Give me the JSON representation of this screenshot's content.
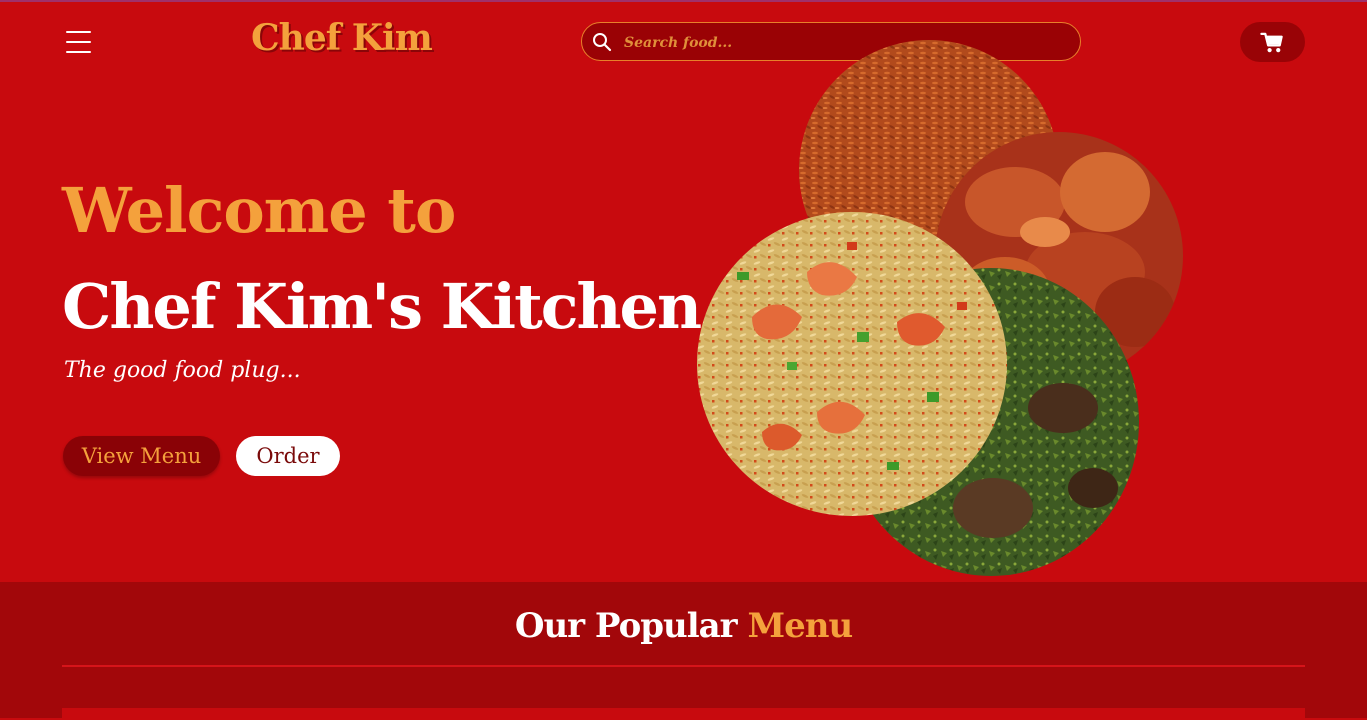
{
  "header": {
    "logo": "Chef Kim",
    "search_placeholder": "Search food...",
    "menu_icon": "hamburger-menu-icon",
    "search_icon": "search-icon",
    "cart_icon": "shopping-cart-icon"
  },
  "hero": {
    "welcome": "Welcome to",
    "title": "Chef Kim's Kitchen",
    "subtitle": "The good food plug...",
    "view_menu_label": "View Menu",
    "order_label": "Order",
    "images": [
      "jollof-rice-image",
      "fried-chicken-image",
      "vegetable-soup-image",
      "shrimp-fried-rice-image"
    ]
  },
  "popular": {
    "heading_part1": "Our Popular",
    "heading_part2": "Menu"
  },
  "colors": {
    "background": "#c80a0e",
    "accent": "#f4a13c",
    "dark_red": "#990306",
    "section": "#a2070a"
  }
}
